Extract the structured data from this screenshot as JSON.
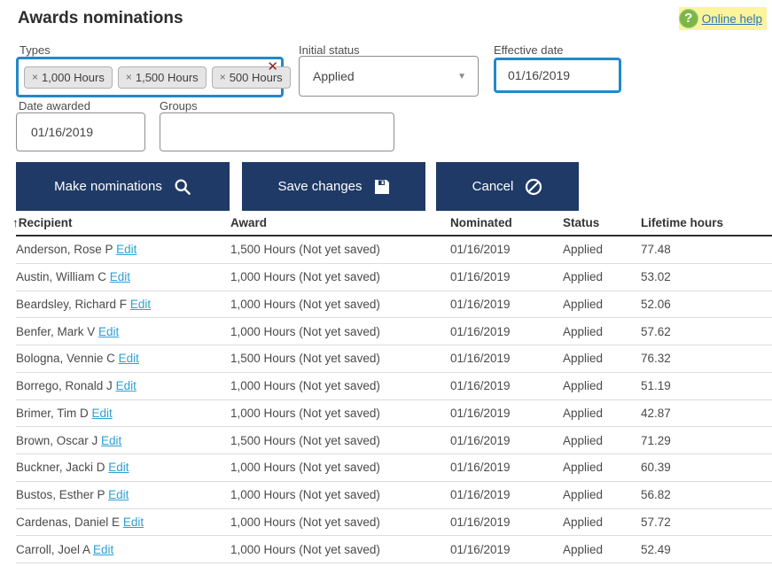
{
  "page": {
    "title": "Awards nominations"
  },
  "help": {
    "label": "Online help"
  },
  "icons": {
    "question_glyph": "?",
    "chip_remove_glyph": "×",
    "clear_glyph": "✕",
    "caret_glyph": "▼",
    "sort_asc_glyph": "↑"
  },
  "colors": {
    "button_navy": "#1f3a66",
    "focus_border_blue": "#2389c7",
    "link_blue": "#2a76b9",
    "edit_link_blue": "#2d9fd6",
    "help_highlight_yellow": "#fbf49b",
    "help_icon_green": "#7cb647",
    "clear_red": "#8e1f1f"
  },
  "form": {
    "types": {
      "label": "Types",
      "tags": [
        "1,000 Hours",
        "1,500 Hours",
        "500 Hours"
      ]
    },
    "initial_status": {
      "label": "Initial status",
      "value": "Applied"
    },
    "effective_date": {
      "label": "Effective date",
      "value": "01/16/2019"
    },
    "date_awarded": {
      "label": "Date awarded",
      "value": "01/16/2019"
    },
    "groups": {
      "label": "Groups",
      "value": ""
    }
  },
  "buttons": {
    "make_nominations": "Make nominations",
    "save_changes": "Save changes",
    "cancel": "Cancel"
  },
  "table": {
    "columns": [
      "Recipient",
      "Award",
      "Nominated",
      "Status",
      "Lifetime hours"
    ],
    "sorted_by": "Recipient",
    "sort_direction": "ascending",
    "edit_label": "Edit",
    "rows": [
      {
        "recipient": "Anderson, Rose P",
        "award": "1,500 Hours (Not yet saved)",
        "nominated": "01/16/2019",
        "status": "Applied",
        "lifetime_hours": "77.48"
      },
      {
        "recipient": "Austin, William C",
        "award": "1,000 Hours (Not yet saved)",
        "nominated": "01/16/2019",
        "status": "Applied",
        "lifetime_hours": "53.02"
      },
      {
        "recipient": "Beardsley, Richard F",
        "award": "1,000 Hours (Not yet saved)",
        "nominated": "01/16/2019",
        "status": "Applied",
        "lifetime_hours": "52.06"
      },
      {
        "recipient": "Benfer, Mark V",
        "award": "1,000 Hours (Not yet saved)",
        "nominated": "01/16/2019",
        "status": "Applied",
        "lifetime_hours": "57.62"
      },
      {
        "recipient": "Bologna, Vennie C",
        "award": "1,500 Hours (Not yet saved)",
        "nominated": "01/16/2019",
        "status": "Applied",
        "lifetime_hours": "76.32"
      },
      {
        "recipient": "Borrego, Ronald J",
        "award": "1,000 Hours (Not yet saved)",
        "nominated": "01/16/2019",
        "status": "Applied",
        "lifetime_hours": "51.19"
      },
      {
        "recipient": "Brimer, Tim D",
        "award": "1,000 Hours (Not yet saved)",
        "nominated": "01/16/2019",
        "status": "Applied",
        "lifetime_hours": "42.87"
      },
      {
        "recipient": "Brown, Oscar J",
        "award": "1,500 Hours (Not yet saved)",
        "nominated": "01/16/2019",
        "status": "Applied",
        "lifetime_hours": "71.29"
      },
      {
        "recipient": "Buckner, Jacki D",
        "award": "1,000 Hours (Not yet saved)",
        "nominated": "01/16/2019",
        "status": "Applied",
        "lifetime_hours": "60.39"
      },
      {
        "recipient": "Bustos, Esther P",
        "award": "1,000 Hours (Not yet saved)",
        "nominated": "01/16/2019",
        "status": "Applied",
        "lifetime_hours": "56.82"
      },
      {
        "recipient": "Cardenas, Daniel E",
        "award": "1,000 Hours (Not yet saved)",
        "nominated": "01/16/2019",
        "status": "Applied",
        "lifetime_hours": "57.72"
      },
      {
        "recipient": "Carroll, Joel A",
        "award": "1,000 Hours (Not yet saved)",
        "nominated": "01/16/2019",
        "status": "Applied",
        "lifetime_hours": "52.49"
      }
    ]
  }
}
